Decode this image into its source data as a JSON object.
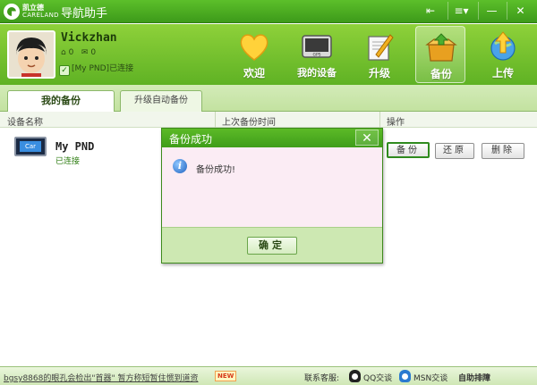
{
  "window": {
    "logo_cn": "凯立德",
    "logo_en": "CARELAND",
    "title": "导航助手",
    "buttons": {
      "tools": "⇤",
      "menu": "≡▾",
      "minimize": "—",
      "close": "✕"
    }
  },
  "user": {
    "name": "Vickzhan",
    "count_a": "0",
    "count_b": "0",
    "device_status": "[My PND]已连接"
  },
  "nav": [
    {
      "label": "欢迎",
      "icon": "heart-icon"
    },
    {
      "label": "我的设备",
      "icon": "gps-device-icon"
    },
    {
      "label": "升级",
      "icon": "upgrade-icon"
    },
    {
      "label": "备份",
      "icon": "backup-box-icon",
      "active": true
    },
    {
      "label": "上传",
      "icon": "upload-globe-icon"
    }
  ],
  "tabs": {
    "my_backup": "我的备份",
    "auto_backup": "升级自动备份"
  },
  "table": {
    "headers": {
      "device_name": "设备名称",
      "last_backup": "上次备份时间",
      "actions": "操作"
    },
    "row": {
      "name": "My PND",
      "status": "已连接",
      "icon_text": "Car",
      "buttons": {
        "backup": "备份",
        "restore": "还原",
        "delete": "删除"
      }
    }
  },
  "dialog": {
    "title": "备份成功",
    "close": "✕",
    "message": "备份成功!",
    "ok": "确定"
  },
  "status": {
    "news": "bgsy8868的眼孔会检出\"首器\" 暂方称短暂住惯到道资",
    "new_badge": "NEW",
    "support_label": "联系客服:",
    "qq1": "QQ交谈",
    "qq2": "MSN交谈",
    "brand": "自助排障"
  },
  "colors": {
    "brand_green": "#3d9a1a",
    "header_green": "#8ed13a",
    "dialog_bg": "#fbecf4"
  }
}
